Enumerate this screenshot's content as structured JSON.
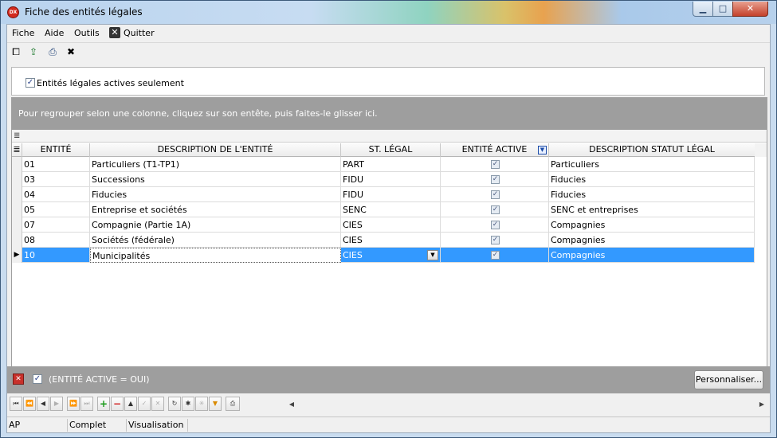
{
  "window": {
    "title": "Fiche des entités légales",
    "app_icon_text": "DX",
    "minimize_glyph": "▁",
    "maximize_glyph": "□",
    "close_glyph": "✕"
  },
  "menu": {
    "items": [
      "Fiche",
      "Aide",
      "Outils"
    ],
    "quit_label": "Quitter",
    "quit_icon": "close-icon"
  },
  "toolbar": {
    "icons": [
      {
        "name": "fit-window-icon",
        "glyph": "⧠"
      },
      {
        "name": "export-icon",
        "glyph": "⇪"
      },
      {
        "name": "print-icon",
        "glyph": "⎙"
      },
      {
        "name": "close-icon",
        "glyph": "✖"
      }
    ]
  },
  "filter": {
    "active_only_label": "Entités légales actives seulement",
    "active_only_checked": true,
    "check_glyph": "✓"
  },
  "grid": {
    "group_hint": "Pour regrouper selon une colonne, cliquez sur son entête, puis faites-le glisser ici.",
    "band_glyph": "≣",
    "columns": [
      "ENTITÉ",
      "DESCRIPTION DE L'ENTITÉ",
      "ST. LÉGAL",
      "ENTITÉ ACTIVE",
      "DESCRIPTION  STATUT LÉGAL"
    ],
    "filter_glyph": "▼",
    "row_indicator": "▶",
    "combo_glyph": "▼",
    "rows": [
      {
        "entite": "01",
        "description": "Particuliers (T1-TP1)",
        "st_legal": "PART",
        "active": true,
        "desc_statut": "Particuliers"
      },
      {
        "entite": "03",
        "description": "Successions",
        "st_legal": "FIDU",
        "active": true,
        "desc_statut": "Fiducies"
      },
      {
        "entite": "04",
        "description": "Fiducies",
        "st_legal": "FIDU",
        "active": true,
        "desc_statut": "Fiducies"
      },
      {
        "entite": "05",
        "description": "Entreprise et sociétés",
        "st_legal": "SENC",
        "active": true,
        "desc_statut": "SENC et entreprises"
      },
      {
        "entite": "07",
        "description": "Compagnie (Partie 1A)",
        "st_legal": "CIES",
        "active": true,
        "desc_statut": "Compagnies"
      },
      {
        "entite": "08",
        "description": "Sociétés (fédérale)",
        "st_legal": "CIES",
        "active": true,
        "desc_statut": "Compagnies"
      },
      {
        "entite": "10",
        "description": "Municipalités",
        "st_legal": "CIES",
        "active": true,
        "desc_statut": "Compagnies"
      }
    ],
    "selected_row": 6
  },
  "filter_bar": {
    "close_glyph": "✕",
    "check_glyph": "✓",
    "text": "(ENTITÉ ACTIVE = OUI)",
    "customize_label": "Personnaliser..."
  },
  "navigator": {
    "buttons": [
      {
        "name": "first-page-button",
        "glyph": "⏮",
        "state": "normal"
      },
      {
        "name": "prev-page-button",
        "glyph": "⏪",
        "state": "normal"
      },
      {
        "name": "prev-record-button",
        "glyph": "◀",
        "state": "normal"
      },
      {
        "name": "next-record-button",
        "glyph": "▶",
        "state": "disabled"
      },
      {
        "name": "next-page-button",
        "glyph": "⏩",
        "state": "disabled"
      },
      {
        "name": "last-page-button",
        "glyph": "⏭",
        "state": "disabled"
      },
      {
        "name": "insert-button",
        "glyph": "+",
        "state": "green"
      },
      {
        "name": "delete-button",
        "glyph": "−",
        "state": "red"
      },
      {
        "name": "edit-button",
        "glyph": "▲",
        "state": "normal"
      },
      {
        "name": "post-button",
        "glyph": "✓",
        "state": "disabled"
      },
      {
        "name": "cancel-button",
        "glyph": "✕",
        "state": "disabled"
      },
      {
        "name": "refresh-button",
        "glyph": "↻",
        "state": "normal"
      },
      {
        "name": "bookmark-button",
        "glyph": "✱",
        "state": "normal"
      },
      {
        "name": "goto-bookmark-button",
        "glyph": "✳",
        "state": "disabled"
      },
      {
        "name": "filter-button",
        "glyph": "▼",
        "state": "funnel"
      },
      {
        "name": "print-grid-button",
        "glyph": "⎙",
        "state": "normal"
      }
    ],
    "scroll_left": "◀",
    "scroll_right": "▶"
  },
  "status": {
    "panels": [
      "AP",
      "Complet",
      "Visualisation",
      ""
    ]
  }
}
